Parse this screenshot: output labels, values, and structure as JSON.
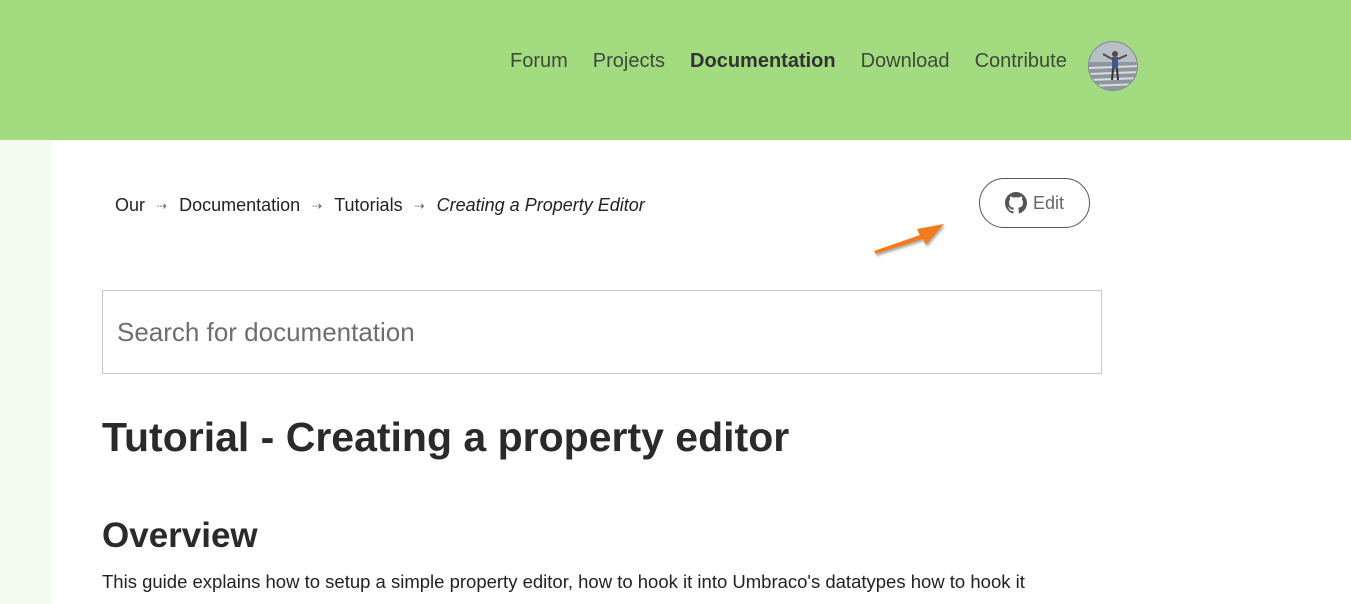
{
  "nav": {
    "items": [
      {
        "label": "Forum"
      },
      {
        "label": "Projects"
      },
      {
        "label": "Documentation",
        "active": true
      },
      {
        "label": "Download"
      },
      {
        "label": "Contribute"
      }
    ]
  },
  "breadcrumb": {
    "items": [
      "Our",
      "Documentation",
      "Tutorials",
      "Creating a Property Editor"
    ]
  },
  "edit_button": {
    "label": "Edit",
    "icon": "github-icon"
  },
  "search": {
    "placeholder": "Search for documentation",
    "value": ""
  },
  "page": {
    "title": "Tutorial - Creating a property editor",
    "section_heading": "Overview",
    "intro": "This guide explains how to setup a simple property editor, how to hook it into Umbraco's datatypes how to hook it"
  },
  "colors": {
    "header_bg": "#a2db80",
    "side_strip": "#f3faee",
    "arrow": "#f07c1e"
  }
}
